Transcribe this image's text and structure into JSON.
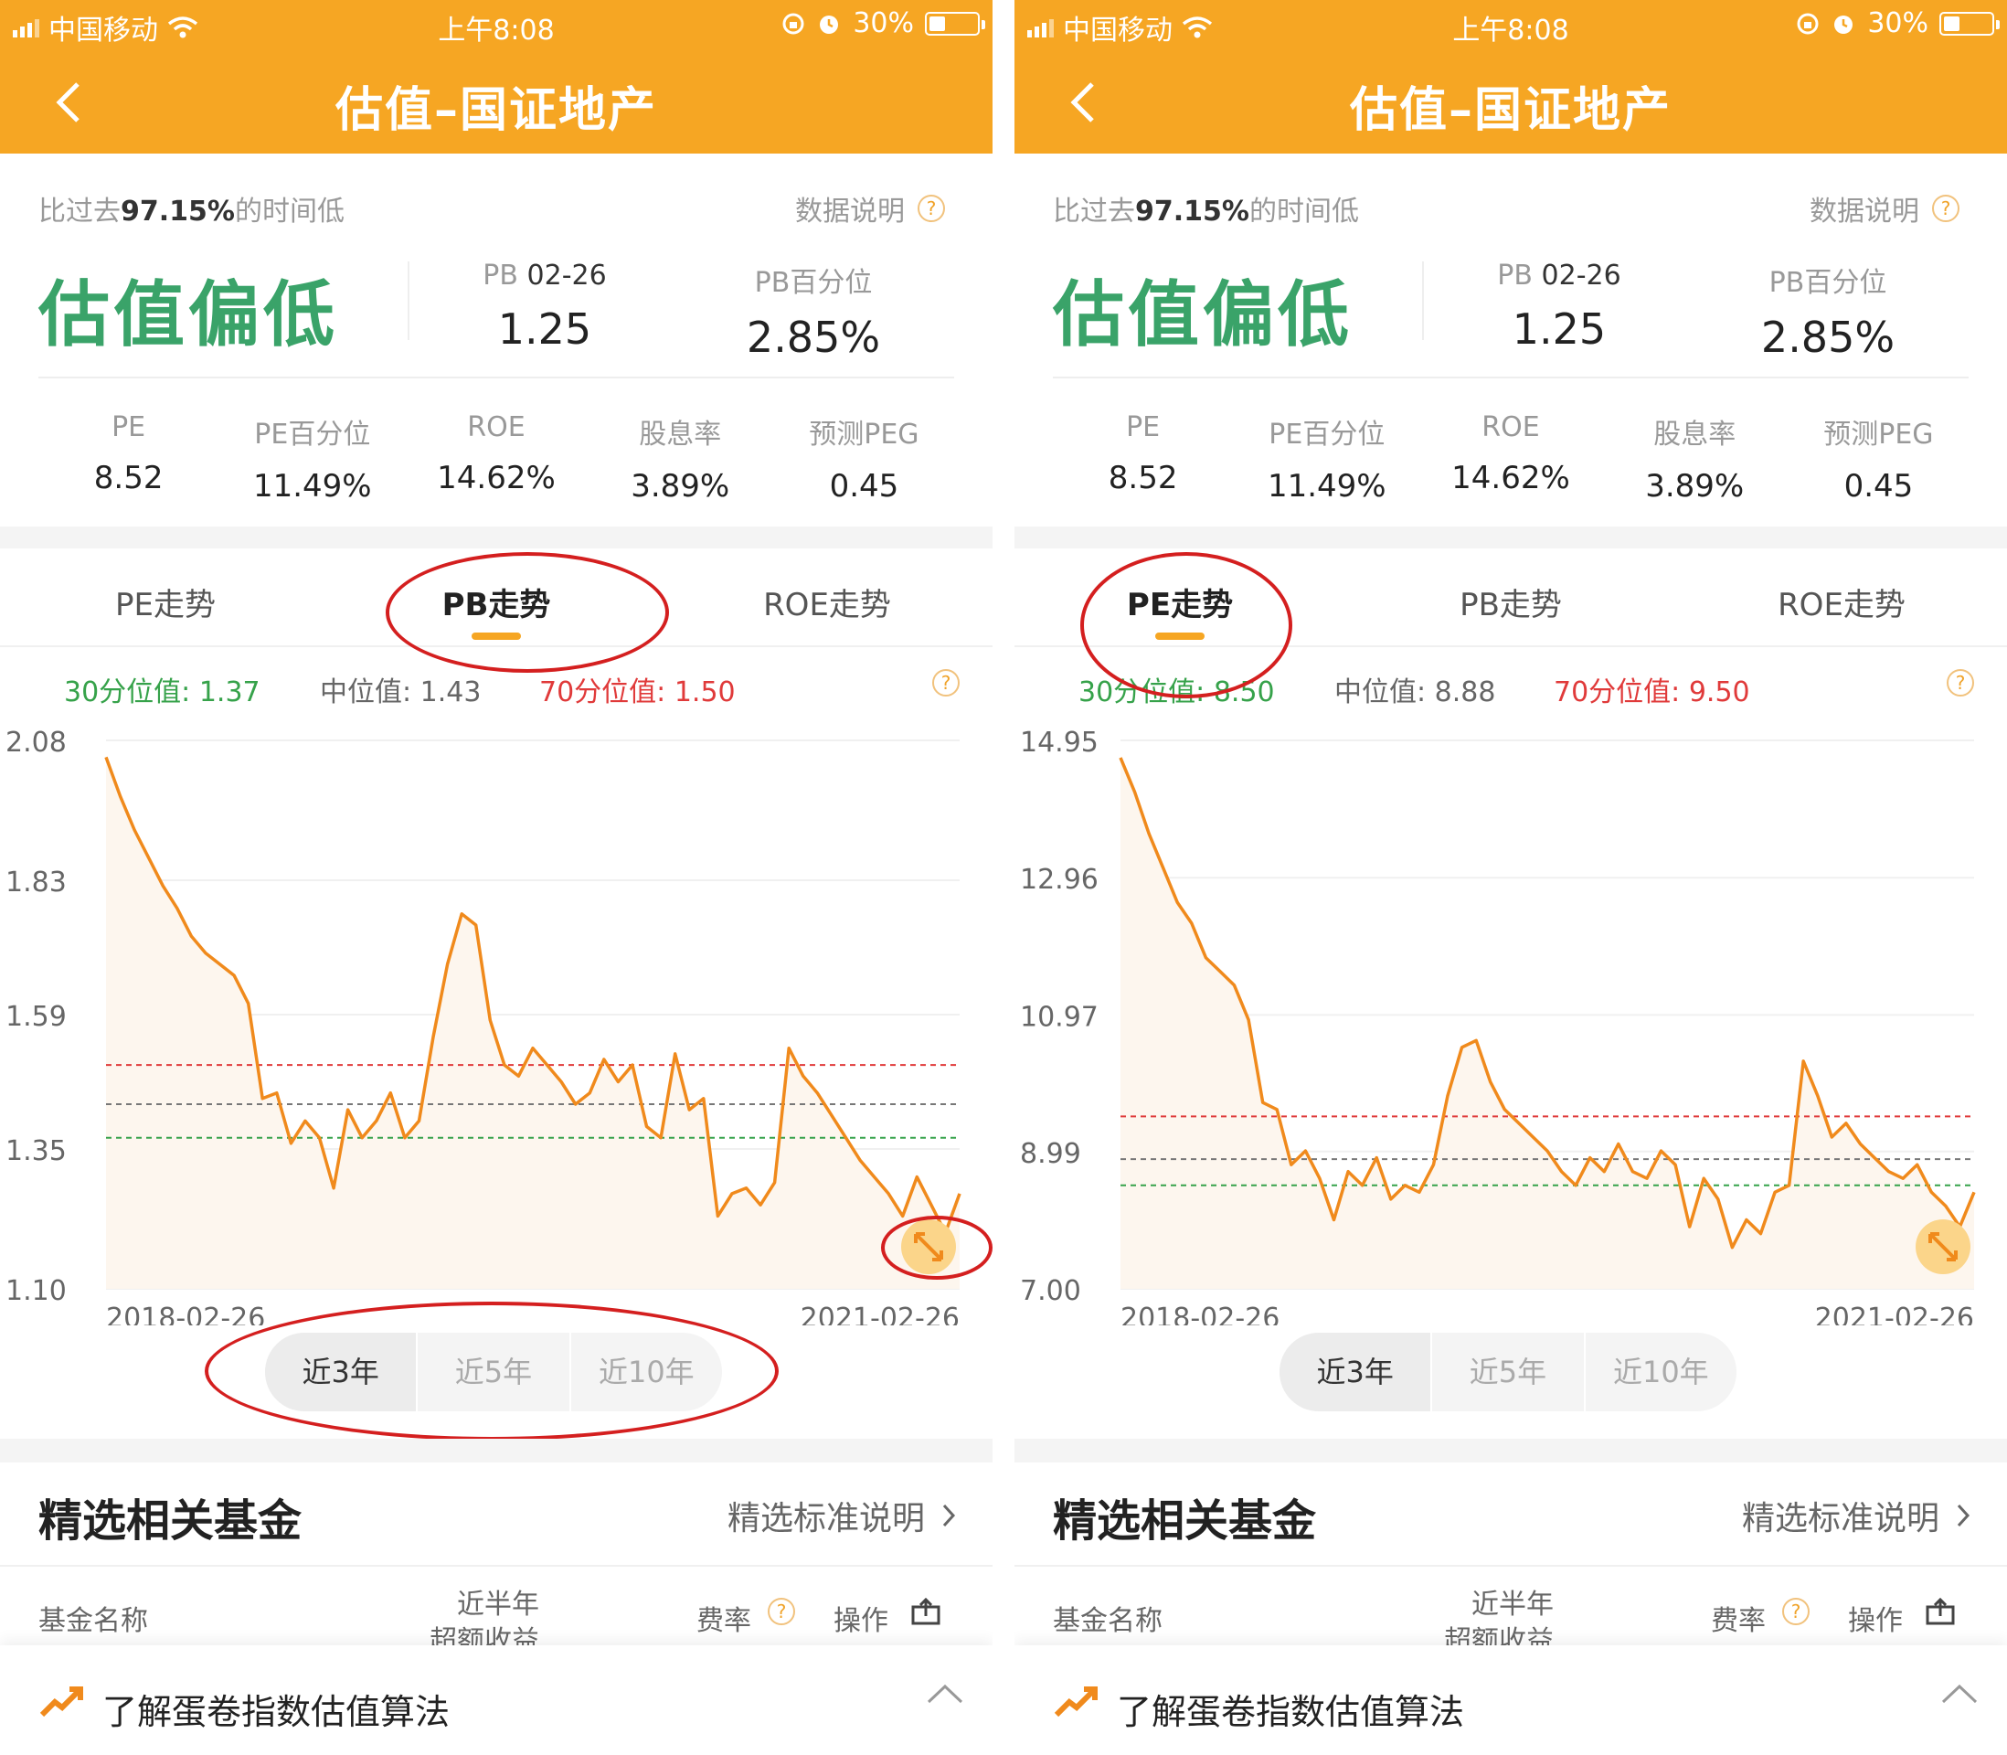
{
  "status": {
    "carrier": "中国移动",
    "time": "上午8:08",
    "battery": "30%"
  },
  "header": {
    "title": "估值–国证地产"
  },
  "summary": {
    "time_prefix": "比过去",
    "time_pct": "97.15%",
    "time_suffix": "的时间低",
    "data_desc": "数据说明",
    "verdict": "估值偏低",
    "pb_label": "PB",
    "pb_date": "02-26",
    "pb_value": "1.25",
    "pb_pct_label": "PB百分位",
    "pb_pct_value": "2.85%"
  },
  "metrics": [
    {
      "label": "PE",
      "value": "8.52"
    },
    {
      "label": "PE百分位",
      "value": "11.49%"
    },
    {
      "label": "ROE",
      "value": "14.62%"
    },
    {
      "label": "股息率",
      "value": "3.89%"
    },
    {
      "label": "预测PEG",
      "value": "0.45"
    }
  ],
  "tabs": [
    "PE走势",
    "PB走势",
    "ROE走势"
  ],
  "ranges": [
    "近3年",
    "近5年",
    "近10年"
  ],
  "funds": {
    "title": "精选相关基金",
    "link": "精选标准说明",
    "col_name": "基金名称",
    "col_return_1": "近半年",
    "col_return_2": "超额收益",
    "col_fee": "费率",
    "col_action": "操作"
  },
  "bottom": {
    "text": "了解蛋卷指数估值算法"
  },
  "colors": {
    "brand": "#f6a623",
    "line": "#f08a1c",
    "p30": "#36a24a",
    "p70": "#e03a3a",
    "verdict": "#3aa369"
  },
  "left_panel": {
    "active_tab": 1,
    "quantiles": {
      "p30": "30分位值: 1.37",
      "median": "中位值: 1.43",
      "p70": "70分位值: 1.50"
    },
    "chart_data": {
      "type": "line",
      "title": "PB走势",
      "yticks": [
        "2.08",
        "1.83",
        "1.59",
        "1.35",
        "1.10"
      ],
      "ylim": [
        1.1,
        2.08
      ],
      "x_labels": [
        "2018-02-26",
        "2021-02-26"
      ],
      "reference_lines": {
        "p30": 1.37,
        "median": 1.43,
        "p70": 1.5
      },
      "values": [
        2.05,
        1.98,
        1.92,
        1.87,
        1.82,
        1.78,
        1.73,
        1.7,
        1.68,
        1.66,
        1.61,
        1.44,
        1.45,
        1.36,
        1.4,
        1.37,
        1.28,
        1.42,
        1.37,
        1.4,
        1.45,
        1.37,
        1.4,
        1.55,
        1.68,
        1.77,
        1.75,
        1.58,
        1.5,
        1.48,
        1.53,
        1.5,
        1.47,
        1.43,
        1.45,
        1.51,
        1.47,
        1.5,
        1.39,
        1.37,
        1.52,
        1.42,
        1.44,
        1.23,
        1.27,
        1.28,
        1.25,
        1.29,
        1.53,
        1.48,
        1.45,
        1.41,
        1.37,
        1.33,
        1.3,
        1.27,
        1.23,
        1.3,
        1.25,
        1.2,
        1.27
      ]
    }
  },
  "right_panel": {
    "active_tab": 0,
    "quantiles": {
      "p30": "30分位值: 8.50",
      "median": "中位值: 8.88",
      "p70": "70分位值: 9.50"
    },
    "chart_data": {
      "type": "line",
      "title": "PE走势",
      "yticks": [
        "14.95",
        "12.96",
        "10.97",
        "8.99",
        "7.00"
      ],
      "ylim": [
        7.0,
        14.95
      ],
      "x_labels": [
        "2018-02-26",
        "2021-02-26"
      ],
      "reference_lines": {
        "p30": 8.5,
        "median": 8.88,
        "p70": 9.5
      },
      "values": [
        14.7,
        14.2,
        13.6,
        13.1,
        12.6,
        12.3,
        11.8,
        11.6,
        11.4,
        10.9,
        9.7,
        9.6,
        8.8,
        9.0,
        8.6,
        8.0,
        8.7,
        8.5,
        8.9,
        8.3,
        8.5,
        8.4,
        8.8,
        9.8,
        10.5,
        10.6,
        10.0,
        9.6,
        9.4,
        9.2,
        9.0,
        8.7,
        8.5,
        8.9,
        8.7,
        9.1,
        8.7,
        8.6,
        9.0,
        8.8,
        7.9,
        8.6,
        8.3,
        7.6,
        8.0,
        7.8,
        8.4,
        8.5,
        10.3,
        9.8,
        9.2,
        9.4,
        9.1,
        8.9,
        8.7,
        8.6,
        8.8,
        8.4,
        8.2,
        7.9,
        8.4
      ]
    }
  }
}
